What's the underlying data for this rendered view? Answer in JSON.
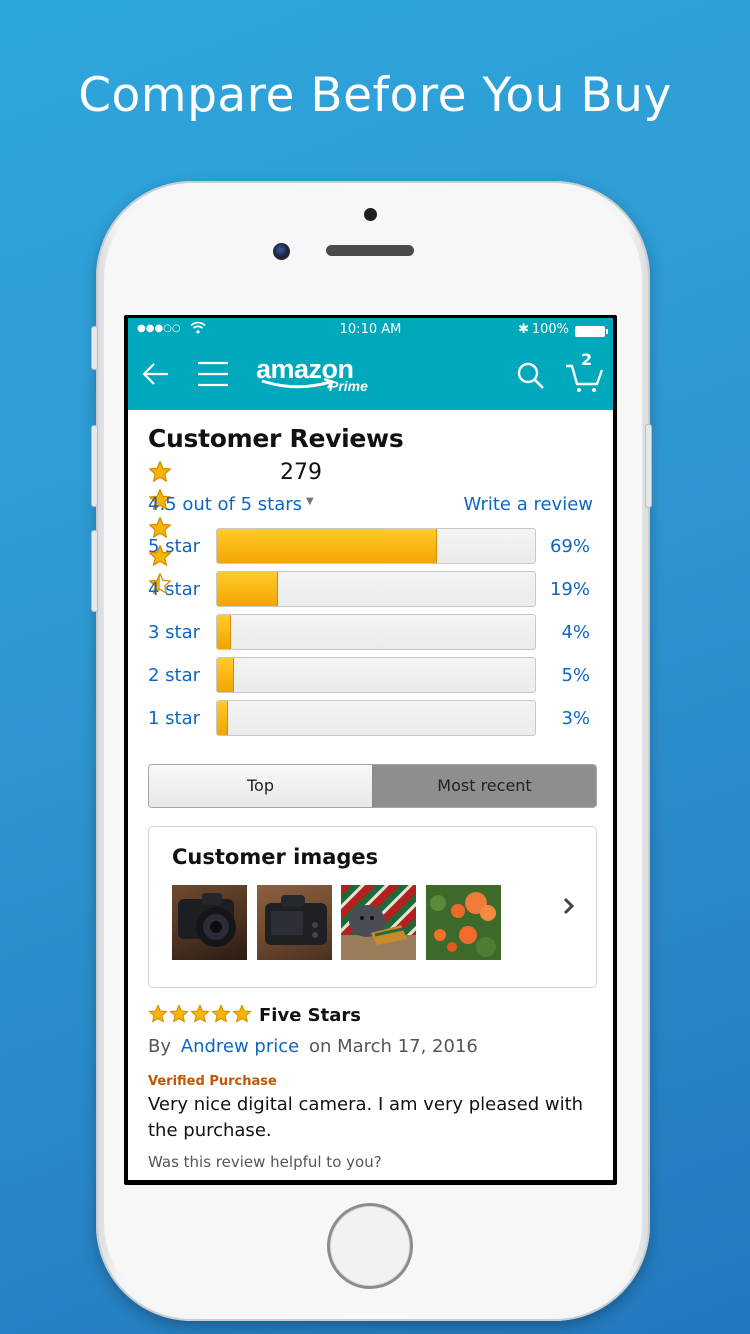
{
  "headline": "Compare Before You Buy",
  "status_bar": {
    "signal": "●●●○○",
    "time": "10:10 AM",
    "bluetooth": "✱",
    "battery_pct": "100%"
  },
  "nav": {
    "logo_word": "amazon",
    "logo_sub": "Prime",
    "cart_count": "2",
    "icons": [
      "back-arrow-icon",
      "menu-icon",
      "search-icon",
      "cart-icon"
    ]
  },
  "reviews": {
    "title": "Customer Reviews",
    "rating": 4.5,
    "rating_count": "279",
    "avg_label": "4.5 out of 5 stars",
    "write_review": "Write a review",
    "histogram": [
      {
        "label": "5 star",
        "pct_label": "69%",
        "pct": 69
      },
      {
        "label": "4 star",
        "pct_label": "19%",
        "pct": 19
      },
      {
        "label": "3 star",
        "pct_label": "4%",
        "pct": 4
      },
      {
        "label": "2 star",
        "pct_label": "5%",
        "pct": 5
      },
      {
        "label": "1 star",
        "pct_label": "3%",
        "pct": 3
      }
    ],
    "sort": {
      "options": [
        "Top",
        "Most recent"
      ],
      "selected": "Most recent"
    }
  },
  "customer_images": {
    "heading": "Customer images",
    "thumbnails": [
      "camera-front-photo",
      "camera-back-photo",
      "dog-in-sweater-photo",
      "orange-flowers-photo"
    ]
  },
  "review": {
    "stars": 5,
    "title": "Five Stars",
    "by": "By",
    "author": "Andrew price",
    "date": "on March 17, 2016",
    "verified": "Verified Purchase",
    "body": "Very nice digital camera. I am very pleased with the purchase.",
    "helpful_prompt": "Was this review helpful to you?"
  },
  "colors": {
    "nav_bg": "#00a8bb",
    "link": "#0f66c0",
    "star": "#f7b400",
    "bar_fill": "#f3a500",
    "verified": "#c45500"
  }
}
